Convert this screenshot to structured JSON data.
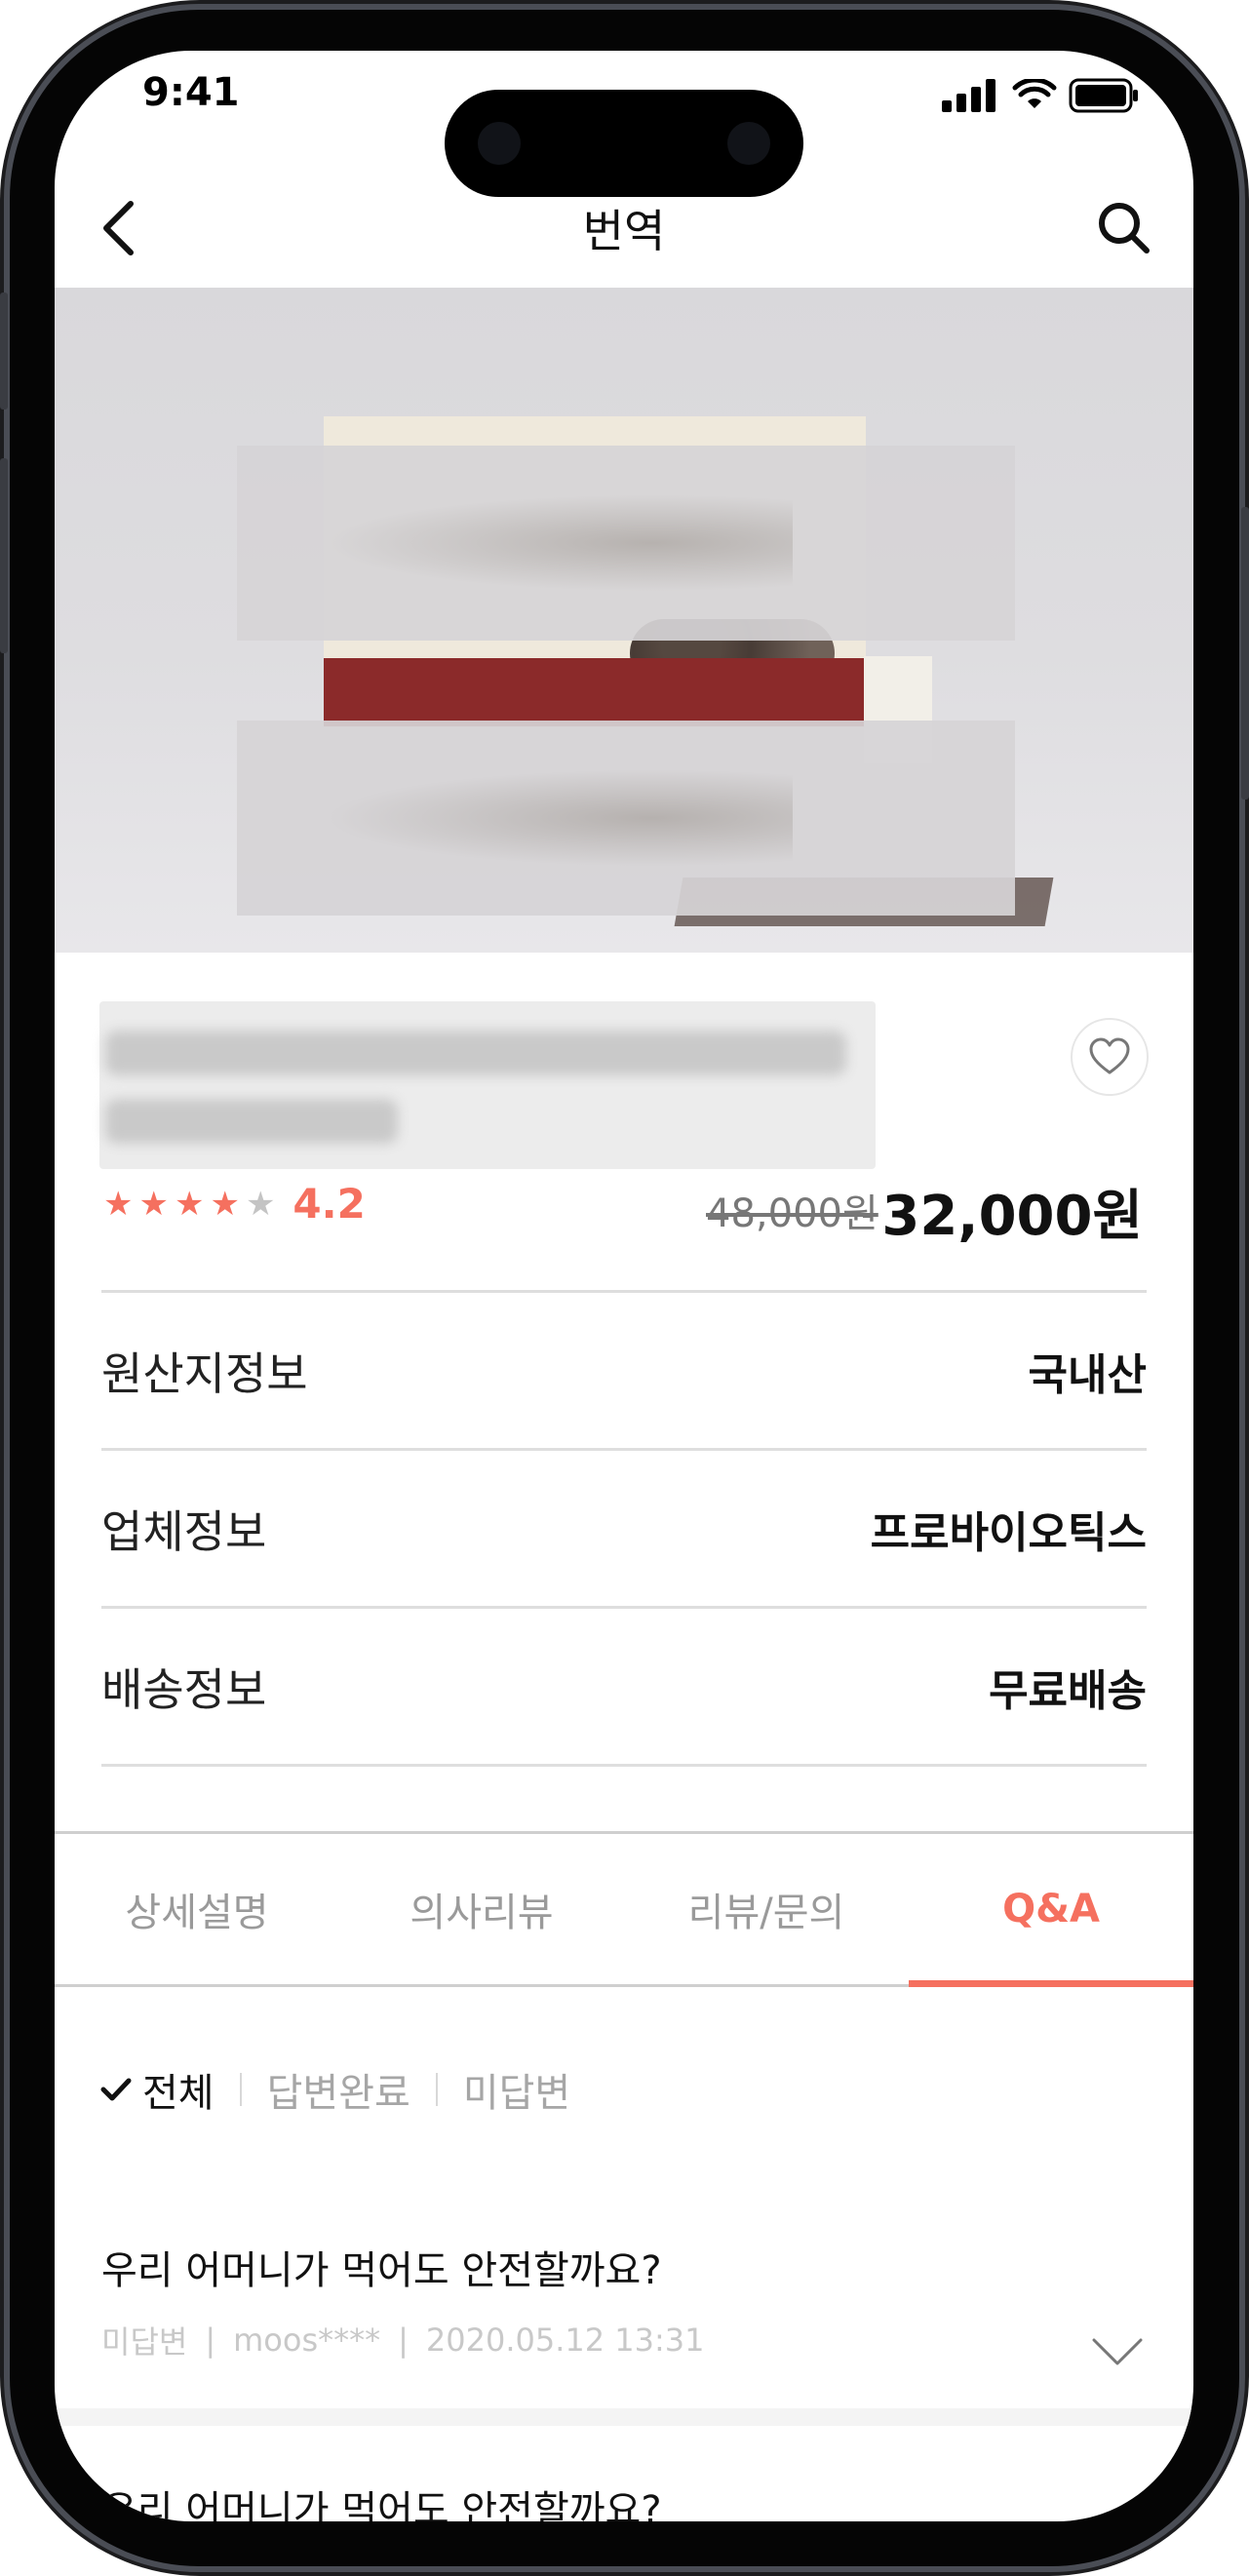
{
  "status_bar": {
    "time": "9:41"
  },
  "nav": {
    "title": "번역"
  },
  "product": {
    "rating": "4.2",
    "stars_filled": 4,
    "stars_total": 5,
    "price_original": "48,000원",
    "price_sale": "32,000원"
  },
  "info": {
    "rows": [
      {
        "label": "원산지정보",
        "value": "국내산"
      },
      {
        "label": "업체정보",
        "value": "프로바이오틱스"
      },
      {
        "label": "배송정보",
        "value": "무료배송"
      }
    ]
  },
  "tabs": [
    {
      "label": "상세설명",
      "active": false
    },
    {
      "label": "의사리뷰",
      "active": false
    },
    {
      "label": "리뷰/문의",
      "active": false
    },
    {
      "label": "Q&A",
      "active": true
    }
  ],
  "filter": {
    "all": "전체",
    "answered": "답변완료",
    "unanswered": "미답변"
  },
  "qa": [
    {
      "question": "우리 어머니가 먹어도 안전할까요?",
      "status": "미답변",
      "user": "moos****",
      "date": "2020.05.12 13:31"
    },
    {
      "question": "우리 어머니가 먹어도 안전할까요?"
    }
  ],
  "colors": {
    "accent": "#f5705f",
    "star_empty": "#c4c4c4"
  },
  "icons": [
    "back-arrow-icon",
    "search-icon",
    "heart-icon",
    "check-icon",
    "chevron-down-icon",
    "signal-icon",
    "wifi-icon",
    "battery-icon"
  ]
}
